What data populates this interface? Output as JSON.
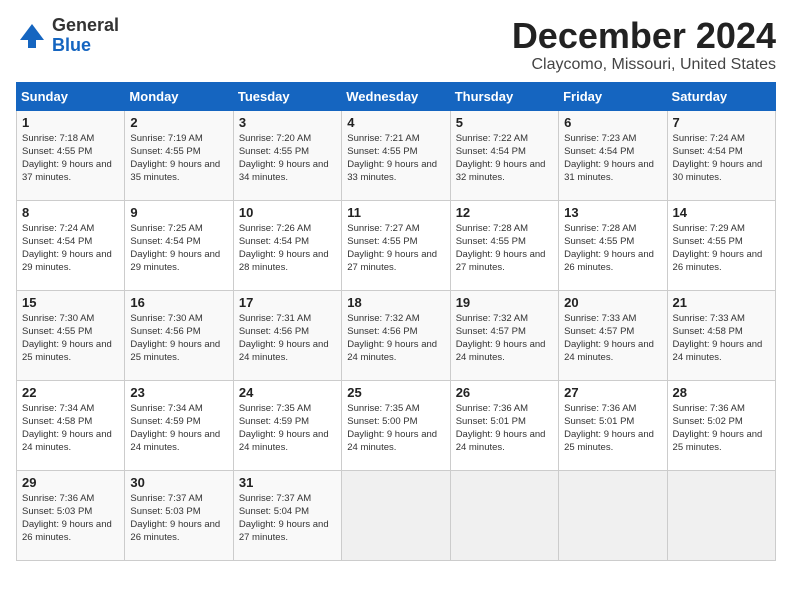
{
  "header": {
    "logo_general": "General",
    "logo_blue": "Blue",
    "month_title": "December 2024",
    "location": "Claycomo, Missouri, United States"
  },
  "calendar": {
    "days_of_week": [
      "Sunday",
      "Monday",
      "Tuesday",
      "Wednesday",
      "Thursday",
      "Friday",
      "Saturday"
    ],
    "weeks": [
      [
        null,
        {
          "day": "2",
          "sunrise": "Sunrise: 7:19 AM",
          "sunset": "Sunset: 4:55 PM",
          "daylight": "Daylight: 9 hours and 35 minutes."
        },
        {
          "day": "3",
          "sunrise": "Sunrise: 7:20 AM",
          "sunset": "Sunset: 4:55 PM",
          "daylight": "Daylight: 9 hours and 34 minutes."
        },
        {
          "day": "4",
          "sunrise": "Sunrise: 7:21 AM",
          "sunset": "Sunset: 4:55 PM",
          "daylight": "Daylight: 9 hours and 33 minutes."
        },
        {
          "day": "5",
          "sunrise": "Sunrise: 7:22 AM",
          "sunset": "Sunset: 4:54 PM",
          "daylight": "Daylight: 9 hours and 32 minutes."
        },
        {
          "day": "6",
          "sunrise": "Sunrise: 7:23 AM",
          "sunset": "Sunset: 4:54 PM",
          "daylight": "Daylight: 9 hours and 31 minutes."
        },
        {
          "day": "7",
          "sunrise": "Sunrise: 7:24 AM",
          "sunset": "Sunset: 4:54 PM",
          "daylight": "Daylight: 9 hours and 30 minutes."
        }
      ],
      [
        {
          "day": "1",
          "sunrise": "Sunrise: 7:18 AM",
          "sunset": "Sunset: 4:55 PM",
          "daylight": "Daylight: 9 hours and 37 minutes."
        },
        null,
        null,
        null,
        null,
        null,
        null
      ],
      [
        {
          "day": "8",
          "sunrise": "Sunrise: 7:24 AM",
          "sunset": "Sunset: 4:54 PM",
          "daylight": "Daylight: 9 hours and 29 minutes."
        },
        {
          "day": "9",
          "sunrise": "Sunrise: 7:25 AM",
          "sunset": "Sunset: 4:54 PM",
          "daylight": "Daylight: 9 hours and 29 minutes."
        },
        {
          "day": "10",
          "sunrise": "Sunrise: 7:26 AM",
          "sunset": "Sunset: 4:54 PM",
          "daylight": "Daylight: 9 hours and 28 minutes."
        },
        {
          "day": "11",
          "sunrise": "Sunrise: 7:27 AM",
          "sunset": "Sunset: 4:55 PM",
          "daylight": "Daylight: 9 hours and 27 minutes."
        },
        {
          "day": "12",
          "sunrise": "Sunrise: 7:28 AM",
          "sunset": "Sunset: 4:55 PM",
          "daylight": "Daylight: 9 hours and 27 minutes."
        },
        {
          "day": "13",
          "sunrise": "Sunrise: 7:28 AM",
          "sunset": "Sunset: 4:55 PM",
          "daylight": "Daylight: 9 hours and 26 minutes."
        },
        {
          "day": "14",
          "sunrise": "Sunrise: 7:29 AM",
          "sunset": "Sunset: 4:55 PM",
          "daylight": "Daylight: 9 hours and 26 minutes."
        }
      ],
      [
        {
          "day": "15",
          "sunrise": "Sunrise: 7:30 AM",
          "sunset": "Sunset: 4:55 PM",
          "daylight": "Daylight: 9 hours and 25 minutes."
        },
        {
          "day": "16",
          "sunrise": "Sunrise: 7:30 AM",
          "sunset": "Sunset: 4:56 PM",
          "daylight": "Daylight: 9 hours and 25 minutes."
        },
        {
          "day": "17",
          "sunrise": "Sunrise: 7:31 AM",
          "sunset": "Sunset: 4:56 PM",
          "daylight": "Daylight: 9 hours and 24 minutes."
        },
        {
          "day": "18",
          "sunrise": "Sunrise: 7:32 AM",
          "sunset": "Sunset: 4:56 PM",
          "daylight": "Daylight: 9 hours and 24 minutes."
        },
        {
          "day": "19",
          "sunrise": "Sunrise: 7:32 AM",
          "sunset": "Sunset: 4:57 PM",
          "daylight": "Daylight: 9 hours and 24 minutes."
        },
        {
          "day": "20",
          "sunrise": "Sunrise: 7:33 AM",
          "sunset": "Sunset: 4:57 PM",
          "daylight": "Daylight: 9 hours and 24 minutes."
        },
        {
          "day": "21",
          "sunrise": "Sunrise: 7:33 AM",
          "sunset": "Sunset: 4:58 PM",
          "daylight": "Daylight: 9 hours and 24 minutes."
        }
      ],
      [
        {
          "day": "22",
          "sunrise": "Sunrise: 7:34 AM",
          "sunset": "Sunset: 4:58 PM",
          "daylight": "Daylight: 9 hours and 24 minutes."
        },
        {
          "day": "23",
          "sunrise": "Sunrise: 7:34 AM",
          "sunset": "Sunset: 4:59 PM",
          "daylight": "Daylight: 9 hours and 24 minutes."
        },
        {
          "day": "24",
          "sunrise": "Sunrise: 7:35 AM",
          "sunset": "Sunset: 4:59 PM",
          "daylight": "Daylight: 9 hours and 24 minutes."
        },
        {
          "day": "25",
          "sunrise": "Sunrise: 7:35 AM",
          "sunset": "Sunset: 5:00 PM",
          "daylight": "Daylight: 9 hours and 24 minutes."
        },
        {
          "day": "26",
          "sunrise": "Sunrise: 7:36 AM",
          "sunset": "Sunset: 5:01 PM",
          "daylight": "Daylight: 9 hours and 24 minutes."
        },
        {
          "day": "27",
          "sunrise": "Sunrise: 7:36 AM",
          "sunset": "Sunset: 5:01 PM",
          "daylight": "Daylight: 9 hours and 25 minutes."
        },
        {
          "day": "28",
          "sunrise": "Sunrise: 7:36 AM",
          "sunset": "Sunset: 5:02 PM",
          "daylight": "Daylight: 9 hours and 25 minutes."
        }
      ],
      [
        {
          "day": "29",
          "sunrise": "Sunrise: 7:36 AM",
          "sunset": "Sunset: 5:03 PM",
          "daylight": "Daylight: 9 hours and 26 minutes."
        },
        {
          "day": "30",
          "sunrise": "Sunrise: 7:37 AM",
          "sunset": "Sunset: 5:03 PM",
          "daylight": "Daylight: 9 hours and 26 minutes."
        },
        {
          "day": "31",
          "sunrise": "Sunrise: 7:37 AM",
          "sunset": "Sunset: 5:04 PM",
          "daylight": "Daylight: 9 hours and 27 minutes."
        },
        null,
        null,
        null,
        null
      ]
    ]
  }
}
